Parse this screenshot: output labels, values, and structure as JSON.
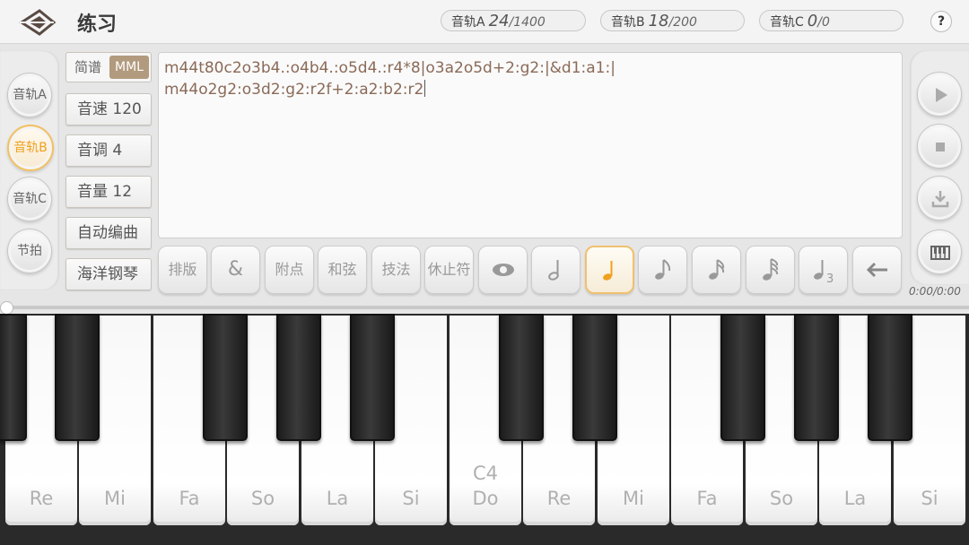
{
  "header": {
    "title": "练习",
    "tracks": [
      {
        "label": "音轨A",
        "value": "24",
        "max": "/1400"
      },
      {
        "label": "音轨B",
        "value": "18",
        "max": "/200"
      },
      {
        "label": "音轨C",
        "value": "0",
        "max": "/0"
      }
    ],
    "help": "?"
  },
  "track_buttons": [
    {
      "label": "音轨A",
      "active": false
    },
    {
      "label": "音轨B",
      "active": true
    },
    {
      "label": "音轨C",
      "active": false
    },
    {
      "label": "节拍",
      "active": false
    }
  ],
  "mode": {
    "jianpu": "简谱",
    "mml": "MML",
    "selected": "MML"
  },
  "settings": {
    "tempo": "音速 120",
    "key": "音调 4",
    "volume": "音量 12",
    "auto_compose": "自动编曲",
    "instrument": "海洋钢琴"
  },
  "editor": {
    "lines": [
      "m44t80c2o3b4.:o4b4.:o5d4.:r4*8|o3a2o5d+2:g2:|&d1:a1:|",
      "m44o2g2:o3d2:g2:r2f+2:a2:b2:r2"
    ]
  },
  "toolbar": {
    "layout": "排版",
    "ampersand": "&",
    "dot": "附点",
    "chord": "和弦",
    "technique": "技法",
    "rest": "休止符",
    "eye_icon": "eye-icon",
    "triplet_digit": "3",
    "selected_note": "quarter-note",
    "backspace_icon": "backspace-icon"
  },
  "transport": {
    "time": "0:00/0:00",
    "icons": [
      "play-icon",
      "stop-icon",
      "download-icon",
      "keyboard-icon"
    ]
  },
  "keyboard": {
    "white_keys": [
      {
        "label": "Re",
        "octave": ""
      },
      {
        "label": "Mi",
        "octave": ""
      },
      {
        "label": "Fa",
        "octave": ""
      },
      {
        "label": "So",
        "octave": ""
      },
      {
        "label": "La",
        "octave": ""
      },
      {
        "label": "Si",
        "octave": ""
      },
      {
        "label": "Do",
        "octave": "C4"
      },
      {
        "label": "Re",
        "octave": ""
      },
      {
        "label": "Mi",
        "octave": ""
      },
      {
        "label": "Fa",
        "octave": ""
      },
      {
        "label": "So",
        "octave": ""
      },
      {
        "label": "La",
        "octave": ""
      },
      {
        "label": "Si",
        "octave": ""
      }
    ]
  },
  "colors": {
    "accent": "#f0a020",
    "mml_selected_bg": "#b29a7e",
    "editor_text": "#8a6a58"
  }
}
